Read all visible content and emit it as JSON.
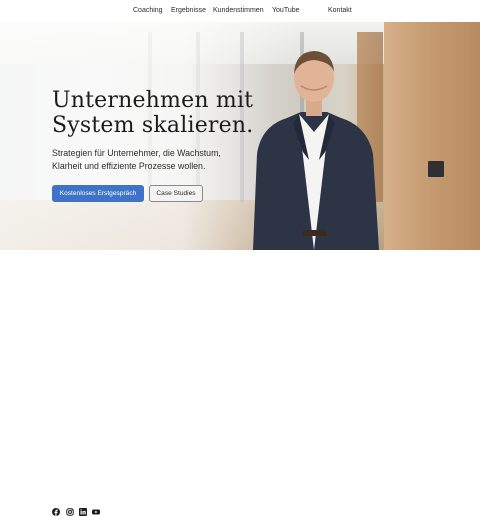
{
  "nav": {
    "items": [
      {
        "label": "Coaching"
      },
      {
        "label": "Ergebnisse"
      },
      {
        "label": "Kundenstimmen"
      },
      {
        "label": "YouTube"
      },
      {
        "label": "Kontakt"
      }
    ]
  },
  "hero": {
    "headline_line1": "Unternehmen mit",
    "headline_line2": "System skalieren.",
    "subtitle_line1": "Strategien für Unternehmer, die Wachstum,",
    "subtitle_line2": "Klarheit und effiziente Prozesse wollen.",
    "cta_primary": "Kostenloses Erstgespräch",
    "cta_secondary": "Case Studies",
    "primary_color": "#3e73c8"
  },
  "footer": {
    "social_icons": [
      "facebook-icon",
      "instagram-icon",
      "linkedin-icon",
      "youtube-icon"
    ]
  }
}
